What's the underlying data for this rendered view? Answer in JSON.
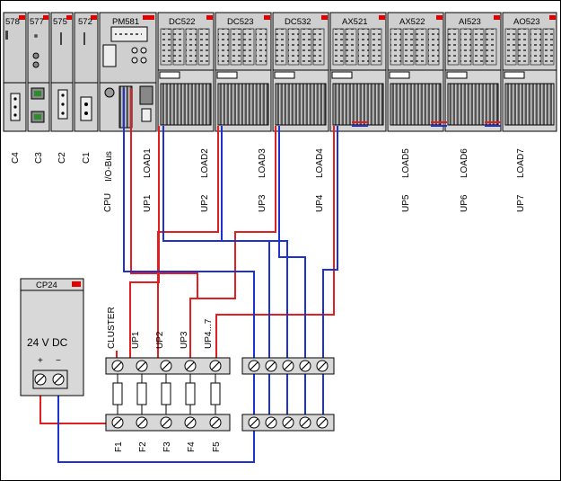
{
  "colors": {
    "live": "#e02020",
    "return": "#1e32d2",
    "module_gray": "#d4d4d4",
    "module_dark": "#b4b4b4",
    "marker": "#e00000",
    "frame": "#000000"
  },
  "modules": [
    {
      "label": "578"
    },
    {
      "label": "577"
    },
    {
      "label": "575"
    },
    {
      "label": "572"
    },
    {
      "label": "PM581"
    },
    {
      "label": "DC522"
    },
    {
      "label": "DC523"
    },
    {
      "label": "DC532"
    },
    {
      "label": "AX521"
    },
    {
      "label": "AX522"
    },
    {
      "label": "AI523"
    },
    {
      "label": "AO523"
    }
  ],
  "bus_labels": [
    {
      "text": "C4"
    },
    {
      "text": "C3"
    },
    {
      "text": "C2"
    },
    {
      "text": "C1"
    },
    {
      "text": "CPU"
    },
    {
      "text": "I/O-Bus"
    },
    {
      "text": "UP1"
    },
    {
      "text": "LOAD1"
    },
    {
      "text": "UP2"
    },
    {
      "text": "LOAD2"
    },
    {
      "text": "UP3"
    },
    {
      "text": "LOAD3"
    },
    {
      "text": "UP4"
    },
    {
      "text": "LOAD4"
    },
    {
      "text": "UP5"
    },
    {
      "text": "LOAD5"
    },
    {
      "text": "UP6"
    },
    {
      "text": "LOAD6"
    },
    {
      "text": "UP7"
    },
    {
      "text": "LOAD7"
    }
  ],
  "fuse_group_labels": [
    {
      "text": "CLUSTER"
    },
    {
      "text": "UP1"
    },
    {
      "text": "UP2"
    },
    {
      "text": "UP3"
    },
    {
      "text": "UP4...7"
    }
  ],
  "fuse_labels": [
    {
      "text": "F1"
    },
    {
      "text": "F2"
    },
    {
      "text": "F3"
    },
    {
      "text": "F4"
    },
    {
      "text": "F5"
    }
  ],
  "power_supply": {
    "title": "CP24",
    "voltage": "24 V DC",
    "plus": "+",
    "minus": "−"
  }
}
